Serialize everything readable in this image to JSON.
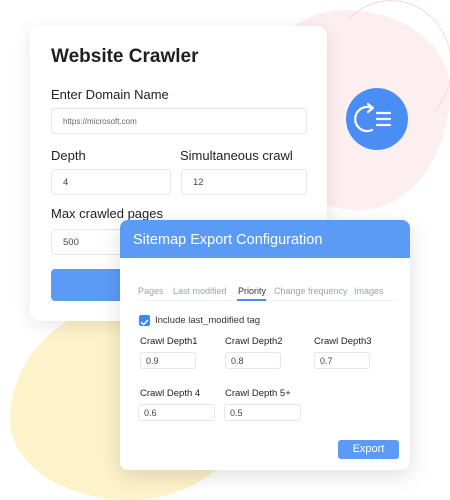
{
  "crawler": {
    "title": "Website Crawler",
    "domain_label": "Enter Domain Name",
    "domain_placeholder": "https://microsoft.com",
    "depth_label": "Depth",
    "depth_value": "4",
    "simultaneous_label": "Simultaneous crawl",
    "simultaneous_value": "12",
    "max_pages_label": "Max crawled pages",
    "max_pages_value": "500"
  },
  "sitemap": {
    "title": "Sitemap Export Configuration",
    "tabs": [
      "Pages",
      "Last modified",
      "Priority",
      "Change frequency",
      "Images"
    ],
    "active_tab": "Priority",
    "checkbox_label": "Include last_modified tag",
    "checkbox_checked": true,
    "depths": [
      {
        "label": "Crawl Depth1",
        "value": "0.9"
      },
      {
        "label": "Crawl Depth2",
        "value": "0.8"
      },
      {
        "label": "Crawl Depth3",
        "value": "0.7"
      },
      {
        "label": "Crawl Depth 4",
        "value": "0.6"
      },
      {
        "label": "Crawl Depth 5+",
        "value": "0.5"
      }
    ],
    "export_label": "Export"
  },
  "colors": {
    "accent": "#5b9af5",
    "icon_circle": "#4a8ef5",
    "pink_blob": "#fdeef0",
    "yellow_blob": "#fdf2c9"
  },
  "icons": {
    "sitemap_list": "sitemap-list-icon"
  }
}
